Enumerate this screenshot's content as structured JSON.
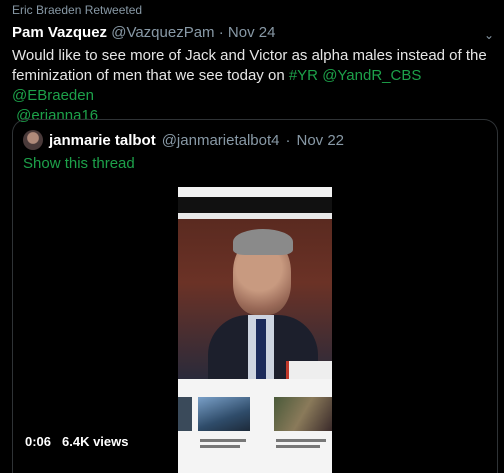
{
  "retweet": {
    "label": "Eric Braeden Retweeted"
  },
  "tweet": {
    "name": "Pam Vazquez",
    "handle": "@VazquezPam",
    "separator": "·",
    "date": "Nov 24",
    "text_plain": "Would like to see more of Jack and Victor as alpha males instead of the feminization of men that we see today on ",
    "hashtag": "#YR",
    "mention_1": "@YandR_CBS",
    "mention_2": "@EBraeden",
    "mention_3": "@erianna16"
  },
  "quoted": {
    "name": "janmarie talbot",
    "handle": "@janmarietalbot4",
    "separator": "·",
    "date": "Nov 22",
    "show_thread": "Show this thread"
  },
  "video": {
    "duration": "0:06",
    "views": "6.4K views"
  },
  "colors": {
    "link": "#1da14a",
    "muted": "#8899a6"
  }
}
